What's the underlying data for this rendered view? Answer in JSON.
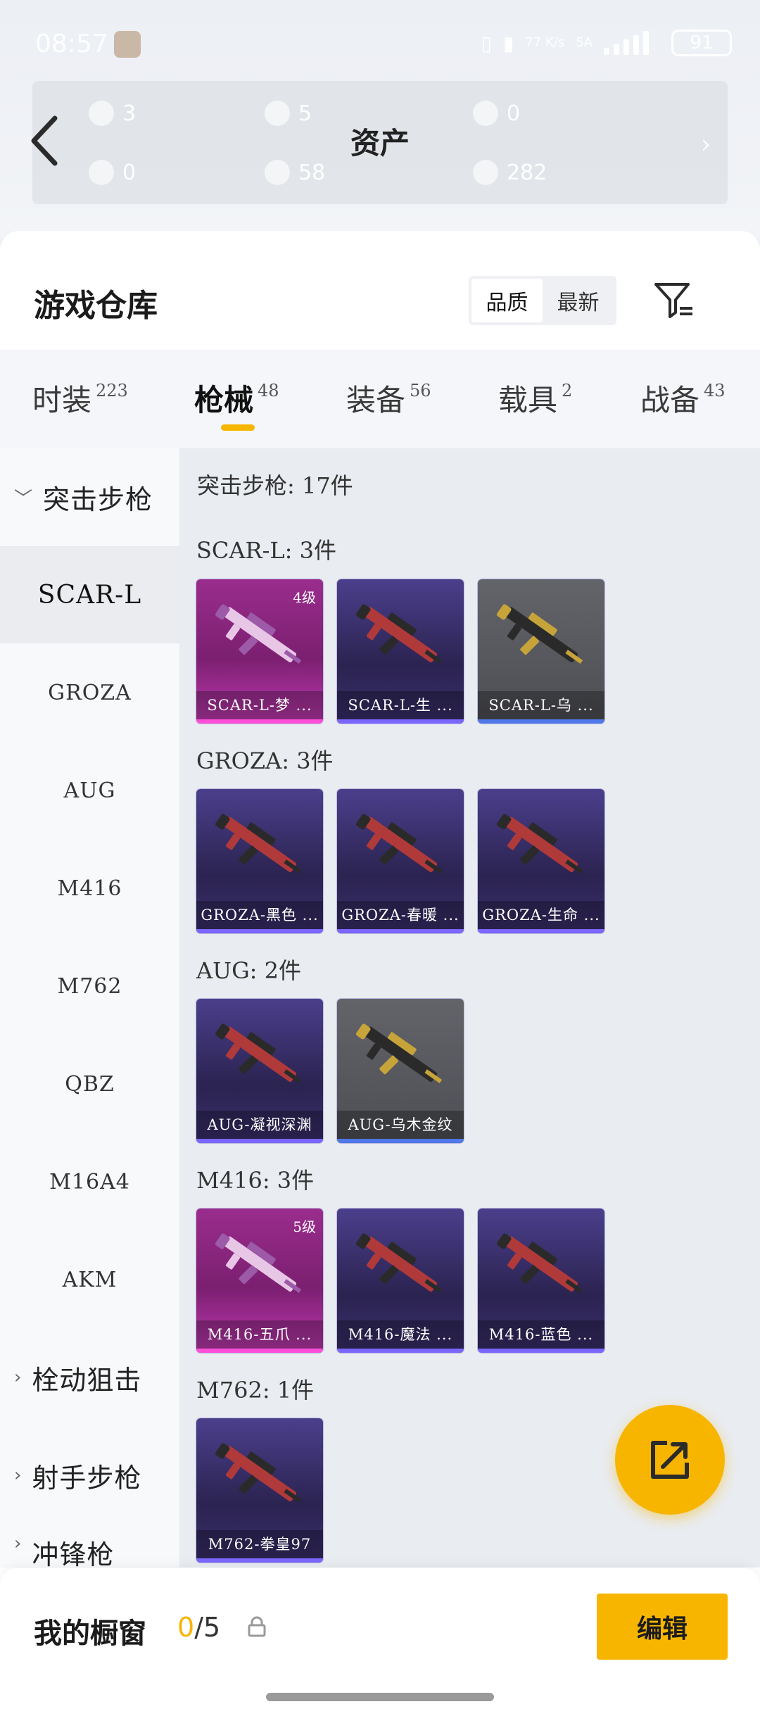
{
  "status_bar": {
    "time": "08:57",
    "network_speed": "77 K/s",
    "signal_label": "5A",
    "battery": "91"
  },
  "assets_header": {
    "title": "资产",
    "stats": [
      "3",
      "5",
      "0",
      "0",
      "58",
      "282"
    ]
  },
  "warehouse": {
    "title": "游戏仓库",
    "sort_options": [
      "品质",
      "最新"
    ],
    "active_sort": "品质"
  },
  "tabs": [
    {
      "label": "时装",
      "count": "223"
    },
    {
      "label": "枪械",
      "count": "48"
    },
    {
      "label": "装备",
      "count": "56"
    },
    {
      "label": "载具",
      "count": "2"
    },
    {
      "label": "战备",
      "count": "43"
    }
  ],
  "active_tab": "枪械",
  "sidebar": {
    "group_open": "突击步枪",
    "items": [
      "SCAR-L",
      "GROZA",
      "AUG",
      "M416",
      "M762",
      "QBZ",
      "M16A4",
      "AKM"
    ],
    "active_item": "SCAR-L",
    "groups_closed": [
      "栓动狙击",
      "射手步枪",
      "冲锋枪"
    ]
  },
  "content": {
    "heading": "突击步枪: 17件",
    "sections": [
      {
        "label": "SCAR-L: 3件",
        "items": [
          {
            "name": "SCAR-L-梦 ...",
            "level": "4级",
            "quality": "pink"
          },
          {
            "name": "SCAR-L-生 ...",
            "level": "",
            "quality": "purple"
          },
          {
            "name": "SCAR-L-乌 ...",
            "level": "",
            "quality": "grey"
          }
        ]
      },
      {
        "label": "GROZA: 3件",
        "items": [
          {
            "name": "GROZA-黑色 ...",
            "level": "",
            "quality": "purple"
          },
          {
            "name": "GROZA-春暖 ...",
            "level": "",
            "quality": "purple"
          },
          {
            "name": "GROZA-生命 ...",
            "level": "",
            "quality": "purple"
          }
        ]
      },
      {
        "label": "AUG: 2件",
        "items": [
          {
            "name": "AUG-凝视深渊",
            "level": "",
            "quality": "purple"
          },
          {
            "name": "AUG-乌木金纹",
            "level": "",
            "quality": "grey"
          }
        ]
      },
      {
        "label": "M416: 3件",
        "items": [
          {
            "name": "M416-五爪 ...",
            "level": "5级",
            "quality": "pink"
          },
          {
            "name": "M416-魔法 ...",
            "level": "",
            "quality": "purple"
          },
          {
            "name": "M416-蓝色 ...",
            "level": "",
            "quality": "purple"
          }
        ]
      },
      {
        "label": "M762: 1件",
        "items": [
          {
            "name": "M762-拳皇97",
            "level": "",
            "quality": "purple"
          }
        ]
      }
    ]
  },
  "showcase": {
    "label": "我的橱窗",
    "current": "0",
    "total": "/5",
    "edit_label": "编辑"
  },
  "colors": {
    "accent": "#f7b500",
    "purple_bar": "#7b66ff",
    "pink_bar": "#ff4fd8",
    "grey_bar": "#4f79e8"
  }
}
